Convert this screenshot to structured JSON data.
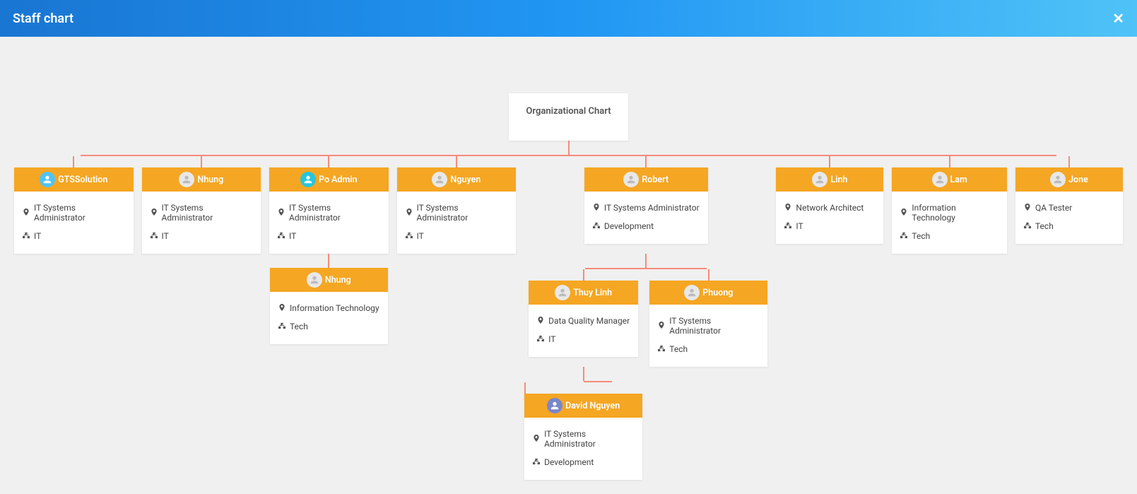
{
  "header": {
    "title": "Staff chart"
  },
  "root": {
    "title": "Organizational Chart"
  },
  "level1": [
    {
      "name": "GTSSolution",
      "role": "IT Systems Administrator",
      "dept": "IT",
      "avatar": "c1"
    },
    {
      "name": "Nhung",
      "role": "IT Systems Administrator",
      "dept": "IT",
      "avatar": ""
    },
    {
      "name": "Po Admin",
      "role": "IT Systems Administrator",
      "dept": "IT",
      "avatar": "c2"
    },
    {
      "name": "Nguyen",
      "role": "IT Systems Administrator",
      "dept": "IT",
      "avatar": ""
    },
    {
      "name": "Robert",
      "role": "IT Systems Administrator",
      "dept": "Development",
      "avatar": ""
    },
    {
      "name": "Linh",
      "role": "Network Architect",
      "dept": "IT",
      "avatar": ""
    },
    {
      "name": "Lam",
      "role": "Information Technology",
      "dept": "Tech",
      "avatar": ""
    },
    {
      "name": "Jone",
      "role": "QA Tester",
      "dept": "Tech",
      "avatar": ""
    }
  ],
  "poAdminChild": {
    "name": "Nhung",
    "role": "Information Technology",
    "dept": "Tech",
    "avatar": ""
  },
  "robertChildren": [
    {
      "name": "Thuy Linh",
      "role": "Data Quality Manager",
      "dept": "IT",
      "avatar": ""
    },
    {
      "name": "Phuong",
      "role": "IT Systems Administrator",
      "dept": "Tech",
      "avatar": ""
    }
  ],
  "thuyLinhChild": {
    "name": "David Nguyen",
    "role": "IT Systems Administrator",
    "dept": "Development",
    "avatar": "c3"
  }
}
